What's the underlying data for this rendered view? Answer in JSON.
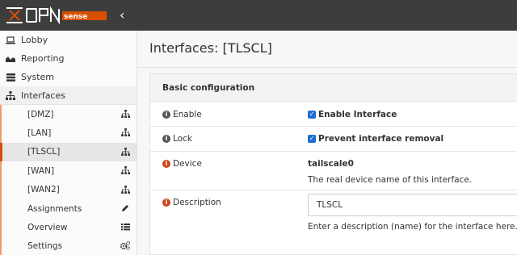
{
  "brand": {
    "name": "OPNsense",
    "accent": "#d94f00"
  },
  "header": {
    "collapse_icon": "chevron-left-icon"
  },
  "sidebar": {
    "items": [
      {
        "label": "Lobby",
        "icon": "laptop-icon"
      },
      {
        "label": "Reporting",
        "icon": "area-chart-icon"
      },
      {
        "label": "System",
        "icon": "server-icon"
      },
      {
        "label": "Interfaces",
        "icon": "sitemap-icon"
      }
    ],
    "sub_items": [
      {
        "label": "[DMZ]",
        "icon": "sitemap-icon"
      },
      {
        "label": "[LAN]",
        "icon": "sitemap-icon"
      },
      {
        "label": "[TLSCL]",
        "icon": "sitemap-icon"
      },
      {
        "label": "[WAN]",
        "icon": "sitemap-icon"
      },
      {
        "label": "[WAN2]",
        "icon": "sitemap-icon"
      },
      {
        "label": "Assignments",
        "icon": "pencil-icon"
      },
      {
        "label": "Overview",
        "icon": "list-icon"
      },
      {
        "label": "Settings",
        "icon": "cogs-icon"
      }
    ]
  },
  "main": {
    "title": "Interfaces: [TLSCL]",
    "panel_title": "Basic configuration",
    "rows": {
      "enable": {
        "label": "Enable",
        "checkbox_label": "Enable Interface",
        "checked": true
      },
      "lock": {
        "label": "Lock",
        "checkbox_label": "Prevent interface removal",
        "checked": true
      },
      "device": {
        "label": "Device",
        "value": "tailscale0",
        "help": "The real device name of this interface."
      },
      "description": {
        "label": "Description",
        "value": "TLSCL",
        "help": "Enter a description (name) for the interface here."
      }
    }
  }
}
